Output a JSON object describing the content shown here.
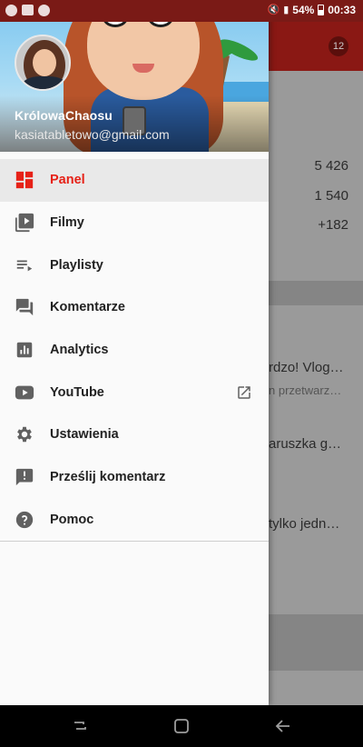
{
  "status_bar": {
    "battery": "54%",
    "time": "00:33"
  },
  "channel": {
    "name": "KrólowaChaosu",
    "email": "kasiatabletowo@gmail.com"
  },
  "menu": {
    "items": [
      {
        "label": "Panel",
        "icon": "dashboard-icon",
        "active": true
      },
      {
        "label": "Filmy",
        "icon": "video-library-icon"
      },
      {
        "label": "Playlisty",
        "icon": "playlist-icon"
      },
      {
        "label": "Komentarze",
        "icon": "comments-icon"
      },
      {
        "label": "Analytics",
        "icon": "bar-chart-icon"
      },
      {
        "label": "YouTube",
        "icon": "youtube-icon",
        "external": true
      },
      {
        "label": "Ustawienia",
        "icon": "gear-icon"
      },
      {
        "label": "Prześlij komentarz",
        "icon": "feedback-icon"
      },
      {
        "label": "Pomoc",
        "icon": "help-icon"
      }
    ]
  },
  "background": {
    "notification_count": "12",
    "stats": [
      "5 426",
      "1 540",
      "+182"
    ],
    "comments": [
      {
        "text": "rdzo! Vlog…",
        "sub": "n przetwarz…"
      },
      {
        "text": "aruszka g…",
        "sub": ""
      },
      {
        "text": "tylko jedn…",
        "sub": ""
      }
    ]
  },
  "colors": {
    "accent": "#e62117",
    "icon": "#616161",
    "statusbar": "#7a1a16"
  }
}
